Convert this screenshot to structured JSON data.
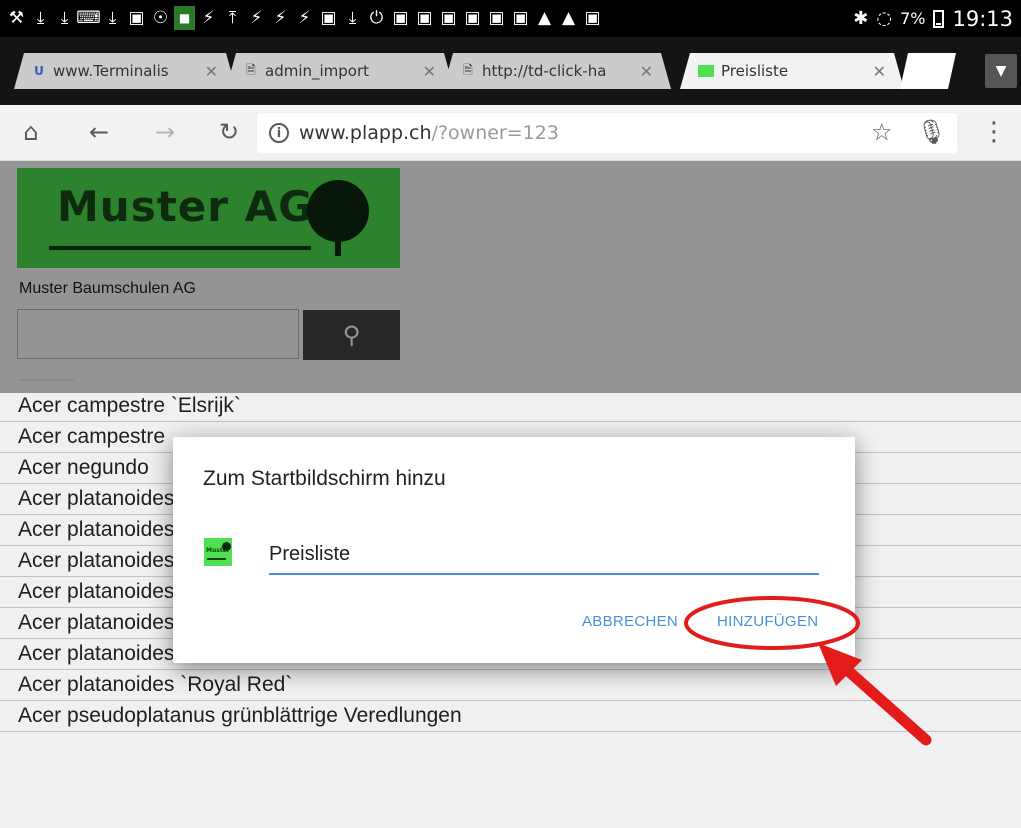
{
  "status_bar": {
    "icons": [
      "wrench-icon",
      "download-icon",
      "download-icon",
      "keyboard-icon",
      "download-icon",
      "image-icon",
      "usb-icon",
      "app-icon",
      "bolt-icon",
      "upload-icon",
      "bolt-icon",
      "bolt-icon",
      "bolt-icon",
      "image-icon",
      "download-icon",
      "power-icon",
      "bag-icon",
      "bag-icon",
      "bag-icon",
      "bag-icon",
      "bag-icon",
      "bag-icon",
      "warning-icon",
      "warning-icon",
      "bag-icon"
    ],
    "battery": "7%",
    "time": "19:13"
  },
  "tabs": [
    {
      "title": "www.Terminalis",
      "favicon": "U",
      "active": false
    },
    {
      "title": "admin_import",
      "favicon": "doc",
      "active": false
    },
    {
      "title": "http://td-click-ha",
      "favicon": "doc",
      "active": false
    },
    {
      "title": "Preisliste",
      "favicon": "muster",
      "active": true
    }
  ],
  "toolbar": {
    "url_host": "www.plapp.ch",
    "url_path": "/?owner=123"
  },
  "page": {
    "logo_text": "Muster AG",
    "company_name": "Muster Baumschulen AG",
    "search_value": "",
    "items": [
      "Acer campestre `Elsrijk`",
      "Acer campestre",
      "Acer negundo",
      "Acer platanoides",
      "Acer platanoides",
      "Acer platanoides",
      "Acer platanoides `Drummondii`",
      "Acer platanoides `Emerald Queen`",
      "Acer platanoides `Globosum`",
      "Acer platanoides `Royal Red`",
      "Acer pseudoplatanus grünblättrige Veredlungen"
    ]
  },
  "dialog": {
    "title": "Zum Startbildschirm hinzu",
    "favicon_text": "Muster",
    "name_value": "Preisliste",
    "cancel_label": "ABBRECHEN",
    "add_label": "HINZUFÜGEN"
  },
  "colors": {
    "accent": "#4a90d9",
    "logo_green": "#4ee04e",
    "annotation_red": "#e31b1b"
  }
}
